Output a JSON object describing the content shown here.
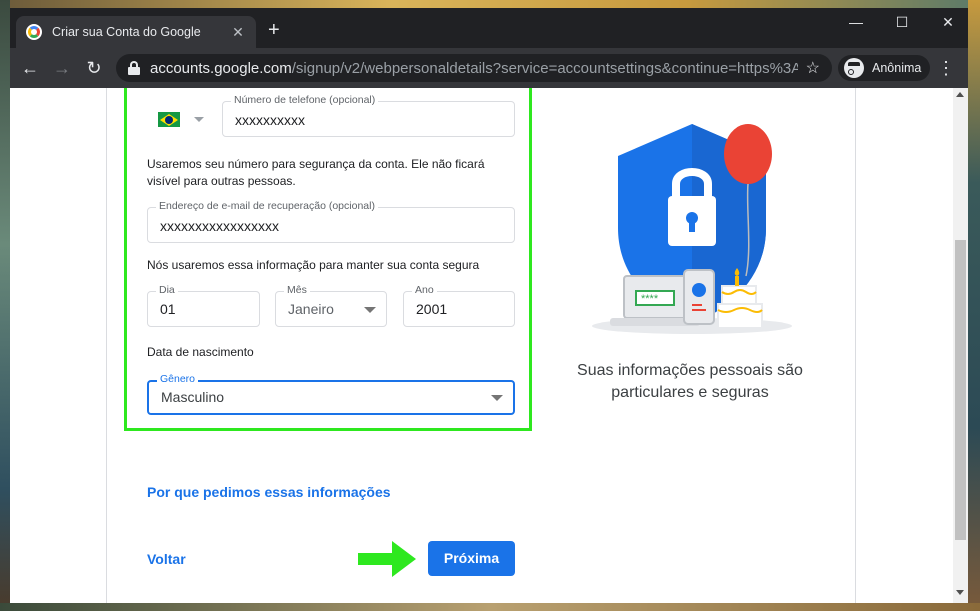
{
  "browser": {
    "tab_title": "Criar sua Conta do Google",
    "tab_close": "✕",
    "new_tab": "+",
    "win_minimize": "—",
    "win_maximize": "☐",
    "win_close": "✕",
    "url_host": "accounts.google.com",
    "url_path": "/signup/v2/webpersonaldetails?service=accountsettings&continue=https%3A%2...",
    "incognito_label": "Anônima",
    "back": "←",
    "forward": "→",
    "reload": "↻",
    "star": "☆",
    "menu": "⋮"
  },
  "form": {
    "phone_label": "Número de telefone (opcional)",
    "phone_value": "xxxxxxxxxx",
    "phone_help_1": "Usaremos seu número para segurança da conta. Ele não ficará",
    "phone_help_2": "visível para outras pessoas.",
    "email_label": "Endereço de e-mail de recuperação (opcional)",
    "email_value": "xxxxxxxxxxxxxxxxx",
    "email_help": "Nós usaremos essa informação para manter sua conta segura",
    "day_label": "Dia",
    "day_value": "01",
    "month_label": "Mês",
    "month_value": "Janeiro",
    "year_label": "Ano",
    "year_value": "2001",
    "birth_help": "Data de nascimento",
    "gender_label": "Gênero",
    "gender_value": "Masculino"
  },
  "why_link": "Por que pedimos essas informações",
  "back_link": "Voltar",
  "next_button": "Próxima",
  "caption_line1": "Suas informações pessoais são",
  "caption_line2": "particulares e seguras",
  "illustration_text": "****",
  "colors": {
    "accent": "#1a73e8",
    "highlight": "#2ee81f",
    "shield": "#1a73e8",
    "balloon": "#ea4335"
  }
}
